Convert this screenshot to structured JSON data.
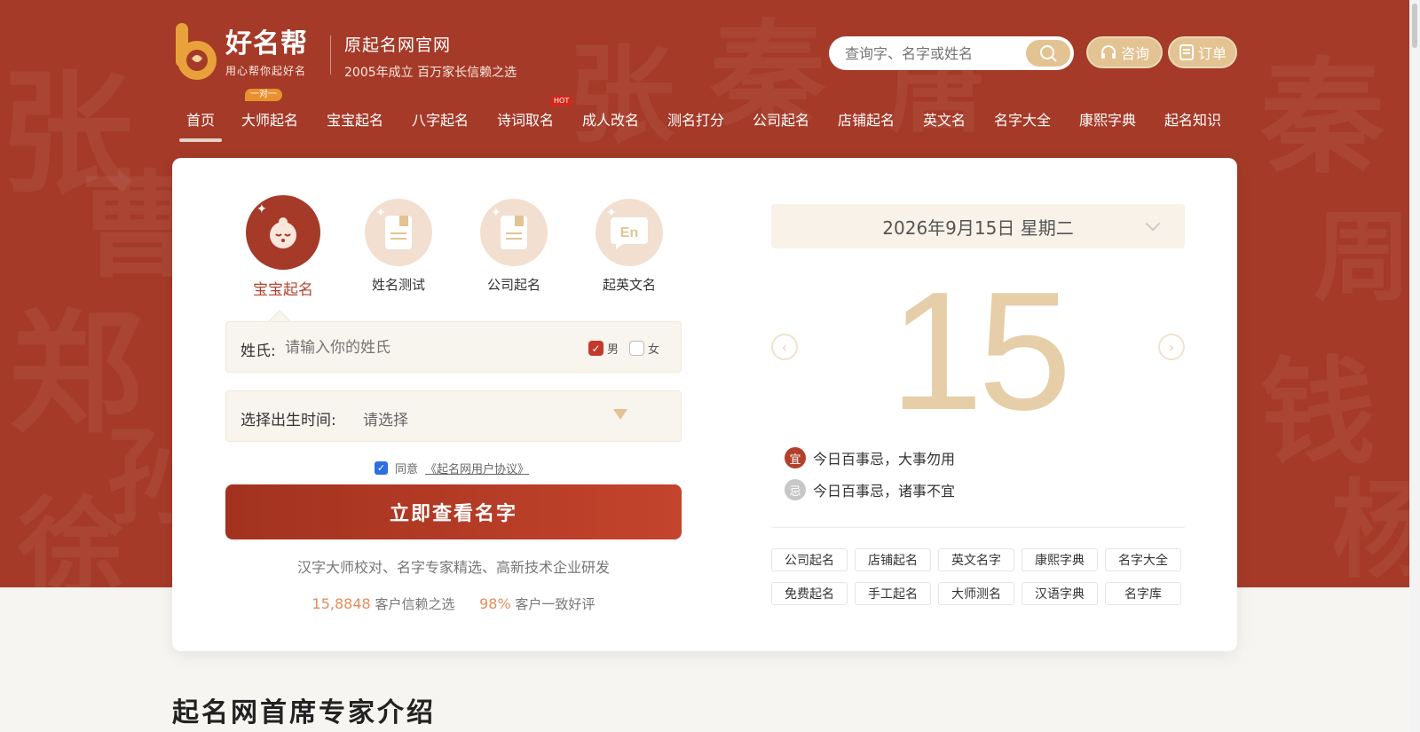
{
  "brand": {
    "name": "好名帮",
    "slogan": "用心帮你起好名",
    "site_title": "原起名网官网",
    "site_subtitle": "2005年成立 百万家长信赖之选"
  },
  "search": {
    "placeholder": "查询字、名字或姓名"
  },
  "header_buttons": {
    "consult": "咨询",
    "order": "订单"
  },
  "nav": {
    "items": [
      {
        "label": "首页",
        "active": true
      },
      {
        "label": "大师起名",
        "badge": "一对一"
      },
      {
        "label": "宝宝起名"
      },
      {
        "label": "八字起名"
      },
      {
        "label": "诗词取名",
        "badge": "HOT"
      },
      {
        "label": "成人改名"
      },
      {
        "label": "测名打分"
      },
      {
        "label": "公司起名"
      },
      {
        "label": "店铺起名"
      },
      {
        "label": "英文名"
      },
      {
        "label": "名字大全"
      },
      {
        "label": "康熙字典"
      },
      {
        "label": "起名知识"
      }
    ]
  },
  "tabs": [
    {
      "label": "宝宝起名",
      "icon": "baby-face-icon",
      "active": true
    },
    {
      "label": "姓名测试",
      "icon": "document-icon"
    },
    {
      "label": "公司起名",
      "icon": "document-icon"
    },
    {
      "label": "起英文名",
      "icon": "en-bubble-icon",
      "glyph": "En"
    }
  ],
  "form": {
    "surname_label": "姓氏:",
    "surname_placeholder": "请输入你的姓氏",
    "male": "男",
    "female": "女",
    "birth_label": "选择出生时间:",
    "birth_value": "请选择",
    "agree_text": "同意",
    "agreement_link": "《起名网用户协议》",
    "submit": "立即查看名字",
    "tagline": "汉字大师校对、名字专家精选、高新技术企业研发",
    "stat1_num": "15,8848",
    "stat1_text": "客户信赖之选",
    "stat2_num": "98%",
    "stat2_text": "客户一致好评"
  },
  "calendar": {
    "date_text": "2026年9月15日 星期二",
    "day": "15",
    "yi_mark": "宜",
    "yi_text": "今日百事忌，大事勿用",
    "ji_mark": "忌",
    "ji_text": "今日百事忌，诸事不宜"
  },
  "quick_links": [
    "公司起名",
    "店铺起名",
    "英文名字",
    "康熙字典",
    "名字大全",
    "免费起名",
    "手工起名",
    "大师测名",
    "汉语字典",
    "名字库"
  ],
  "section_title": "起名网首席专家介绍",
  "colors": {
    "brand_red": "#a53a28",
    "gold": "#e3c392",
    "accent_orange": "#e58d5c"
  }
}
